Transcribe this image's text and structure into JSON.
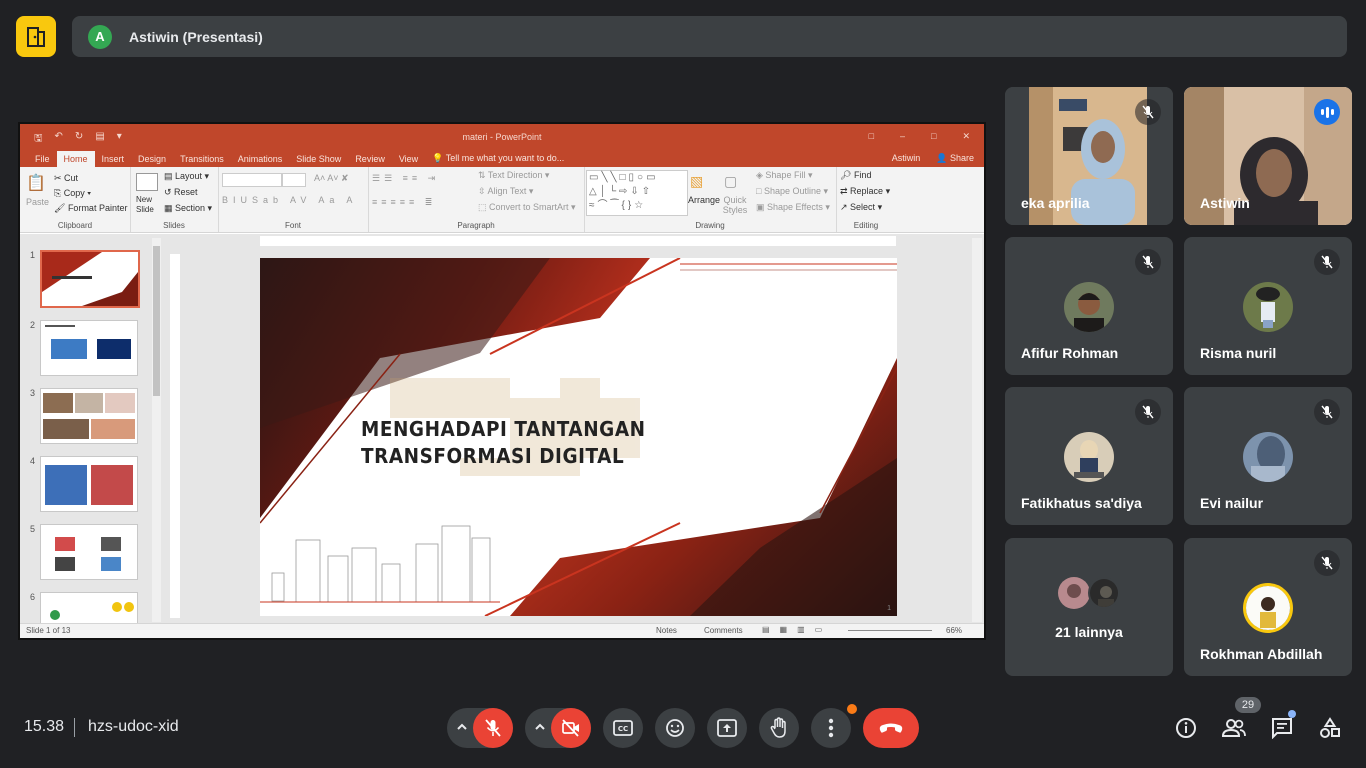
{
  "header": {
    "presenter_initial": "A",
    "presenter_label": "Astiwin (Presentasi)"
  },
  "powerpoint": {
    "window_title": "materi  -  PowerPoint",
    "tabs": [
      "File",
      "Home",
      "Insert",
      "Design",
      "Transitions",
      "Animations",
      "Slide Show",
      "Review",
      "View"
    ],
    "tell_me": "Tell me what you want to do...",
    "user": "Astiwin",
    "share": "Share",
    "ribbon": {
      "clipboard": {
        "paste": "Paste",
        "cut": "Cut",
        "copy": "Copy",
        "format_painter": "Format Painter",
        "label": "Clipboard"
      },
      "slides": {
        "new_slide": "New Slide",
        "layout": "Layout",
        "reset": "Reset",
        "section": "Section",
        "label": "Slides"
      },
      "font": {
        "label": "Font"
      },
      "paragraph": {
        "text_direction": "Text Direction",
        "align_text": "Align Text",
        "smartart": "Convert to SmartArt",
        "label": "Paragraph"
      },
      "drawing": {
        "arrange": "Arrange",
        "quick_styles": "Quick Styles",
        "shape_fill": "Shape Fill",
        "shape_outline": "Shape Outline",
        "shape_effects": "Shape Effects",
        "label": "Drawing"
      },
      "editing": {
        "find": "Find",
        "replace": "Replace",
        "select": "Select",
        "label": "Editing"
      }
    },
    "slide_numbers": [
      "1",
      "2",
      "3",
      "4",
      "5",
      "6"
    ],
    "slide_title": "MENGHADAPI TANTANGAN TRANSFORMASI DIGITAL",
    "slide_page_no": "1",
    "status": {
      "slide_of": "Slide 1 of 13",
      "notes": "Notes",
      "comments": "Comments",
      "zoom": "66%"
    }
  },
  "participants": [
    {
      "name": "eka aprilia",
      "muted": true
    },
    {
      "name": "Astiwin",
      "speaking": true
    },
    {
      "name": "Afifur Rohman",
      "muted": true
    },
    {
      "name": "Risma nuril",
      "muted": true
    },
    {
      "name": "Fatikhatus sa'diya",
      "muted": true
    },
    {
      "name": "Evi nailur",
      "muted": true
    },
    {
      "name": "21 lainnya"
    },
    {
      "name": "Rokhman Abdillah",
      "muted": true
    }
  ],
  "footer": {
    "time": "15.38",
    "meeting_code": "hzs-udoc-xid",
    "participant_count": "29"
  },
  "colors": {
    "background": "#202124",
    "tile": "#3c4043",
    "end_call": "#ea4335",
    "accent_blue": "#1a73e8",
    "logo_yellow": "#f9c80e",
    "ppt_orange": "#c0472b"
  }
}
